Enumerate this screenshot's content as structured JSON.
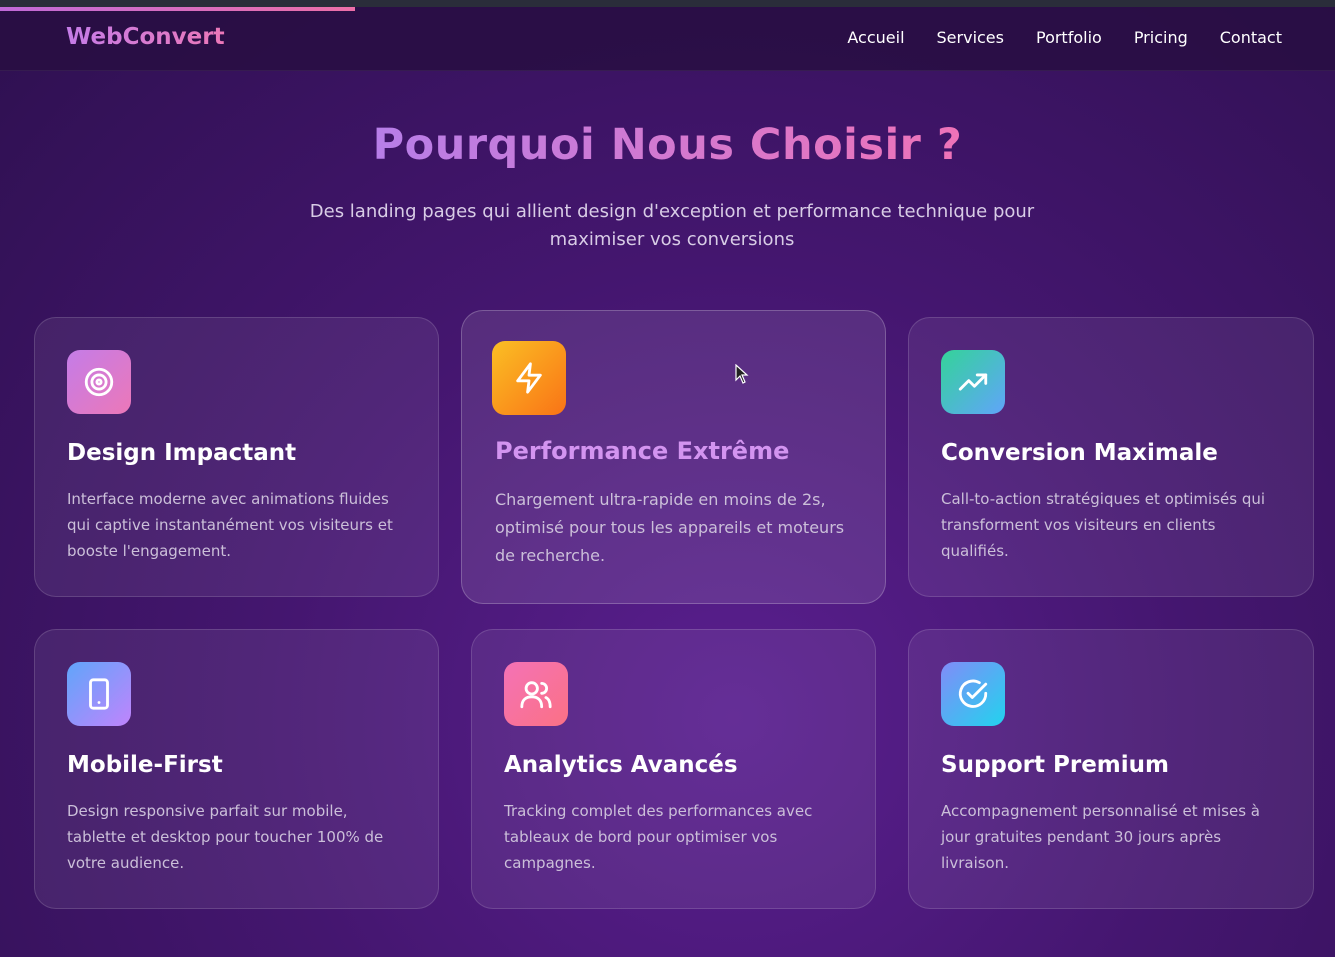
{
  "brand": "WebConvert",
  "nav": [
    "Accueil",
    "Services",
    "Portfolio",
    "Pricing",
    "Contact"
  ],
  "heading": "Pourquoi Nous Choisir ?",
  "subtitle": "Des landing pages qui allient design d'exception et performance technique pour maximiser vos conversions",
  "colors": {
    "accent_purple": "#c47ce8",
    "accent_pink": "#ec78b8",
    "background": "#44166f"
  },
  "features": [
    {
      "icon": "target-icon",
      "title": "Design Impactant",
      "text": "Interface moderne avec animations fluides qui captive instantanément vos visiteurs et booste l'engagement."
    },
    {
      "icon": "lightning-icon",
      "title": "Performance Extrême",
      "text": "Chargement ultra-rapide en moins de 2s, optimisé pour tous les appareils et moteurs de recherche."
    },
    {
      "icon": "trending-up-icon",
      "title": "Conversion Maximale",
      "text": "Call-to-action stratégiques et optimisés qui transforment vos visiteurs en clients qualifiés."
    },
    {
      "icon": "tablet-icon",
      "title": "Mobile-First",
      "text": "Design responsive parfait sur mobile, tablette et desktop pour toucher 100% de votre audience."
    },
    {
      "icon": "users-icon",
      "title": "Analytics Avancés",
      "text": "Tracking complet des performances avec tableaux de bord pour optimiser vos campagnes."
    },
    {
      "icon": "check-circle-icon",
      "title": "Support Premium",
      "text": "Accompagnement personnalisé et mises à jour gratuites pendant 30 jours après livraison."
    }
  ]
}
